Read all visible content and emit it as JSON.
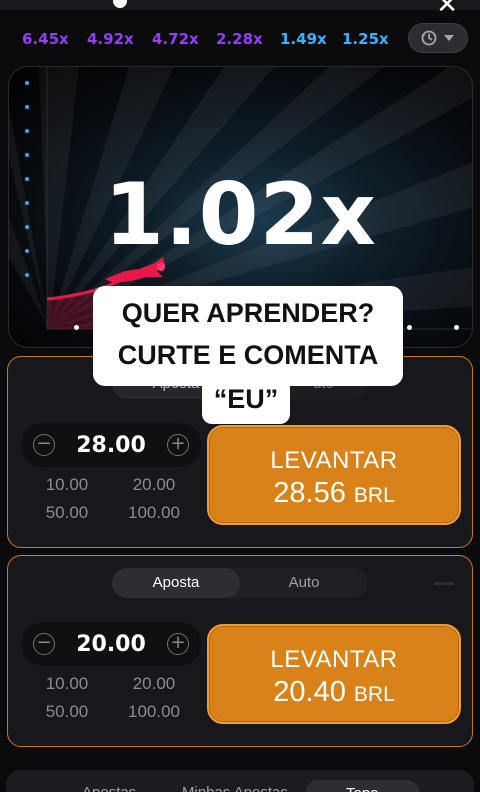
{
  "history": {
    "multipliers": [
      {
        "label": "6.45x",
        "color": "#913ef8"
      },
      {
        "label": "4.92x",
        "color": "#913ef8"
      },
      {
        "label": "4.72x",
        "color": "#913ef8"
      },
      {
        "label": "2.28x",
        "color": "#913ef8"
      },
      {
        "label": "1.49x",
        "color": "#34b4ff"
      },
      {
        "label": "1.25x",
        "color": "#34b4ff"
      }
    ],
    "history_button_icons": [
      "history-clock-icon",
      "chevron-down-icon"
    ]
  },
  "game": {
    "multiplier": "1.02x"
  },
  "overlay": {
    "line1": "QUER APRENDER?",
    "line2": "CURTE E COMENTA",
    "line3": "“EU”"
  },
  "panels": [
    {
      "tabs": {
        "bet": "Aposta",
        "auto": "Auto"
      },
      "partial_tab_left": "Aposta",
      "partial_tab_right": "uto",
      "amount": "28.00",
      "quick": [
        "10.00",
        "20.00",
        "50.00",
        "100.00"
      ],
      "cashout_label": "LEVANTAR",
      "cashout_amount": "28.56",
      "currency": "BRL"
    },
    {
      "tabs": {
        "bet": "Aposta",
        "auto": "Auto"
      },
      "amount": "20.00",
      "quick": [
        "10.00",
        "20.00",
        "50.00",
        "100.00"
      ],
      "cashout_label": "LEVANTAR",
      "cashout_amount": "20.40",
      "currency": "BRL"
    }
  ],
  "bottom_tabs": {
    "all": "Apostas",
    "mine": "Minhas Apostas",
    "top": "Topo"
  },
  "colors": {
    "accent": "#d98219",
    "panel_border": "#c47a1a",
    "plane": "#e8194a"
  }
}
